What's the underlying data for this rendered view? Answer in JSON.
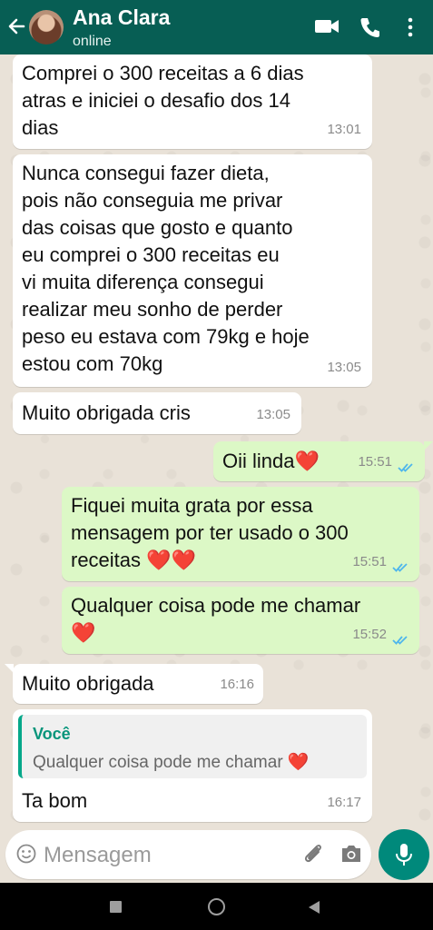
{
  "header": {
    "contact_name": "Ana Clara",
    "status": "online",
    "icons": [
      "back-arrow-icon",
      "video-call-icon",
      "phone-icon",
      "more-vert-icon"
    ],
    "color": "#075e54"
  },
  "messages": [
    {
      "direction": "incoming",
      "text": "Comprei o 300 receitas a 6 dias\natras e iniciei o desafio dos 14\ndias",
      "time": "13:01"
    },
    {
      "direction": "incoming",
      "text": "Nunca consegui fazer dieta,\npois não conseguia me privar\ndas coisas que gosto e quanto\neu comprei o 300 receitas eu\nvi muita diferença consegui\nrealizar meu sonho de perder\npeso eu estava com 79kg e hoje\nestou com 70kg",
      "time": "13:05"
    },
    {
      "direction": "incoming",
      "text": "Muito obrigada cris",
      "time": "13:05"
    },
    {
      "direction": "outgoing",
      "text": "Oii linda❤️",
      "time": "15:51",
      "status": "read"
    },
    {
      "direction": "outgoing",
      "text": "Fiquei muita grata por essa\nmensagem por ter usado o 300\nreceitas ❤️❤️",
      "time": "15:51",
      "status": "read"
    },
    {
      "direction": "outgoing",
      "text": "Qualquer coisa pode me chamar\n❤️",
      "time": "15:52",
      "status": "read"
    },
    {
      "direction": "incoming",
      "text": "Muito obrigada",
      "time": "16:16"
    },
    {
      "direction": "incoming",
      "reply_to": {
        "author": "Você",
        "text": "Qualquer coisa pode me chamar ❤️"
      },
      "text": "Ta bom",
      "time": "16:17"
    }
  ],
  "composer": {
    "placeholder": "Mensagem",
    "icons": [
      "emoji-icon",
      "attach-icon",
      "camera-icon",
      "mic-icon"
    ]
  },
  "colors": {
    "incoming_bubble": "#ffffff",
    "outgoing_bubble": "#dcf8c6",
    "read_ticks": "#4fb6ec",
    "accent": "#00897b"
  }
}
